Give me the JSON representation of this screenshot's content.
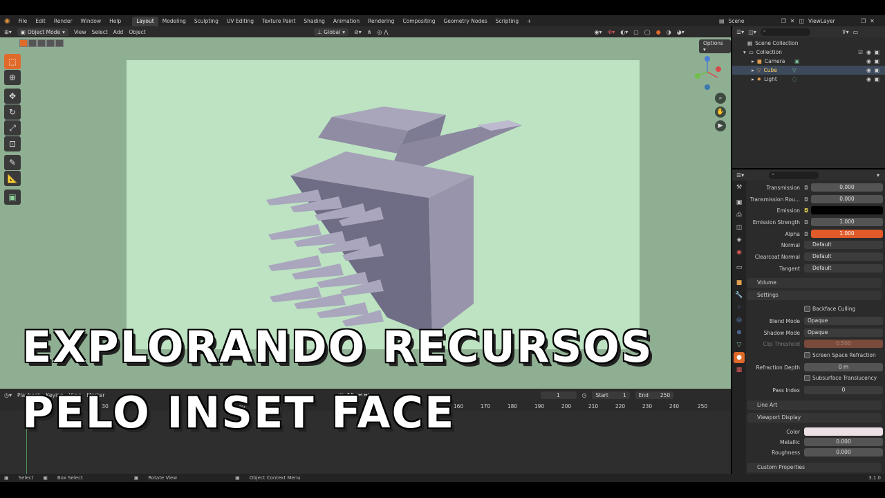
{
  "topbar": {
    "menus": [
      "File",
      "Edit",
      "Render",
      "Window",
      "Help"
    ],
    "workspaces": [
      "Layout",
      "Modeling",
      "Sculpting",
      "UV Editing",
      "Texture Paint",
      "Shading",
      "Animation",
      "Rendering",
      "Compositing",
      "Geometry Nodes",
      "Scripting"
    ],
    "active_workspace": "Layout",
    "scene": "Scene",
    "view_layer": "ViewLayer"
  },
  "viewport": {
    "mode": "Object Mode",
    "menus": [
      "View",
      "Select",
      "Add",
      "Object"
    ],
    "orientation": "Global",
    "options_label": "Options",
    "background_color": "#8faf92",
    "camera_color": "#bde3c2"
  },
  "overlay": {
    "line1": "EXPLORANDO RECURSOS",
    "line2": "PELO INSET FACE"
  },
  "timeline": {
    "menus": [
      "Playback",
      "Keying",
      "View",
      "Marker"
    ],
    "current_frame": "1",
    "start_label": "Start",
    "start": "1",
    "end_label": "End",
    "end": "250",
    "ticks": [
      "140",
      "150",
      "160",
      "170",
      "180",
      "190",
      "200",
      "210",
      "220",
      "230",
      "240",
      "250"
    ],
    "ticks_partial": [
      "30",
      "50"
    ]
  },
  "statusbar": {
    "items": [
      "Select",
      "Box Select",
      "Rotate View",
      "Object Context Menu"
    ],
    "version": "3.1.0"
  },
  "outliner": {
    "root": "Scene Collection",
    "collection": "Collection",
    "items": [
      {
        "label": "Camera",
        "selected": false
      },
      {
        "label": "Cube",
        "selected": true
      },
      {
        "label": "Light",
        "selected": false
      }
    ]
  },
  "properties": {
    "rows": [
      {
        "label": "Transmission",
        "value": "0.000",
        "style": "num"
      },
      {
        "label": "Transmission Rou...",
        "value": "0.000",
        "style": "num"
      },
      {
        "label": "Emission",
        "value": "",
        "style": "black"
      },
      {
        "label": "Emission Strength",
        "value": "1.000",
        "style": "num"
      },
      {
        "label": "Alpha",
        "value": "1.000",
        "style": "orange"
      },
      {
        "label": "Normal",
        "value": "Default",
        "style": "dark"
      },
      {
        "label": "Clearcoat Normal",
        "value": "Default",
        "style": "dark"
      },
      {
        "label": "Tangent",
        "value": "Default",
        "style": "dark"
      }
    ],
    "volume_panel": "Volume",
    "settings_panel": "Settings",
    "backface_culling": "Backface Culling",
    "blend_mode_label": "Blend Mode",
    "blend_mode": "Opaque",
    "shadow_mode_label": "Shadow Mode",
    "shadow_mode": "Opaque",
    "clip_threshold_label": "Clip Threshold",
    "clip_threshold": "0.500",
    "screen_space_refraction": "Screen Space Refraction",
    "refraction_depth_label": "Refraction Depth",
    "refraction_depth": "0 m",
    "subsurface_translucency": "Subsurface Translucency",
    "pass_index_label": "Pass Index",
    "pass_index": "0",
    "line_art_panel": "Line Art",
    "viewport_display_panel": "Viewport Display",
    "color_label": "Color",
    "metallic_label": "Metallic",
    "metallic": "0.000",
    "roughness_label": "Roughness",
    "roughness": "0.000",
    "custom_properties_panel": "Custom Properties"
  }
}
